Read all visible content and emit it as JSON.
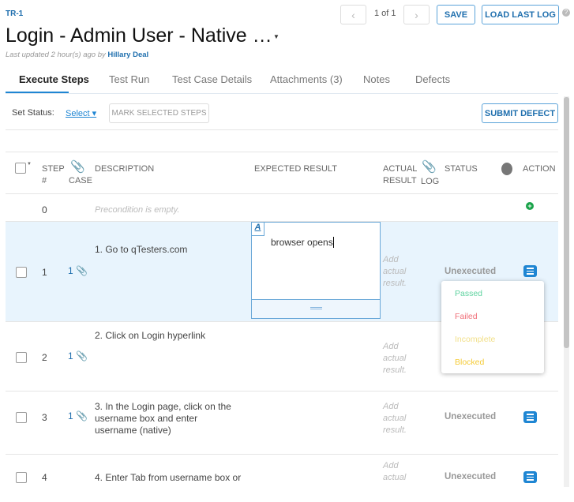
{
  "header": {
    "id": "TR-1",
    "title": "Login - Admin User - Native …",
    "updated_prefix": "Last updated 2 hour(s) ago by",
    "updated_by": "Hillary Deal",
    "pager": "1 of 1",
    "save": "SAVE",
    "load_last_log": "LOAD LAST LOG"
  },
  "tabs": [
    {
      "label": "Execute Steps",
      "active": true
    },
    {
      "label": "Test Run"
    },
    {
      "label": "Test Case Details"
    },
    {
      "label": "Attachments (3)"
    },
    {
      "label": "Notes"
    },
    {
      "label": "Defects"
    }
  ],
  "toolbar": {
    "set_status": "Set Status:",
    "select": "Select",
    "mark_selected": "MARK SELECTED STEPS",
    "submit_defect": "SUBMIT DEFECT"
  },
  "columns": {
    "step": "STEP",
    "step2": "#",
    "case": "CASE",
    "description": "DESCRIPTION",
    "expected": "EXPECTED RESULT",
    "actual": "ACTUAL",
    "actual2": "RESULT",
    "log": "LOG",
    "status": "STATUS",
    "action": "ACTION"
  },
  "precondition": {
    "step": "0",
    "text": "Precondition is empty."
  },
  "steps": [
    {
      "step": "1",
      "case": "1",
      "description": "1. Go to qTesters.com",
      "expected": "browser opens",
      "actual_placeholder": "Add actual result.",
      "status": "Unexecuted"
    },
    {
      "step": "2",
      "case": "1",
      "description": "2. Click on Login hyperlink",
      "actual_placeholder": "Add actual result."
    },
    {
      "step": "3",
      "case": "1",
      "description": "3. In the Login page, click on the username box and enter username (native)",
      "actual_placeholder": "Add actual result.",
      "status": "Unexecuted"
    },
    {
      "step": "4",
      "description": "4. Enter Tab from username box or",
      "actual_placeholder": "Add actual",
      "status": "Unexecuted"
    }
  ],
  "status_menu": [
    {
      "label": "Passed",
      "color": "#5fd3a0"
    },
    {
      "label": "Failed",
      "color": "#f0707a"
    },
    {
      "label": "Incomplete",
      "color": "#f2e08a"
    },
    {
      "label": "Blocked",
      "color": "#f5cc3a"
    }
  ],
  "colors": {
    "accent": "#1f86d3",
    "row_highlight": "#e8f4fd"
  }
}
